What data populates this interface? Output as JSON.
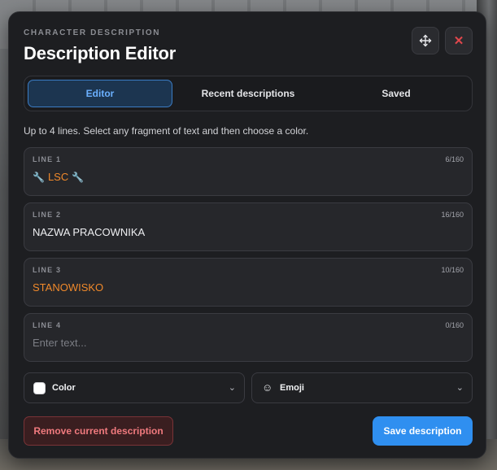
{
  "header": {
    "subtitle": "CHARACTER DESCRIPTION",
    "title": "Description Editor",
    "move_icon": "move-arrows-icon",
    "close_icon": "close-icon",
    "close_glyph": "✕"
  },
  "tabs": [
    {
      "label": "Editor",
      "active": true
    },
    {
      "label": "Recent descriptions",
      "active": false
    },
    {
      "label": "Saved",
      "active": false
    }
  ],
  "hint": "Up to 4 lines. Select any fragment of text and then choose a color.",
  "lines": [
    {
      "label": "LINE 1",
      "count": "6/160",
      "prefix_icon": "wrench-icon",
      "text": "LSC",
      "suffix_icon": "wrench-icon",
      "text_color": "#f0892b"
    },
    {
      "label": "LINE 2",
      "count": "16/160",
      "text": "NAZWA PRACOWNIKA",
      "text_color": "#eeeff2"
    },
    {
      "label": "LINE 3",
      "count": "10/160",
      "text": "STANOWISKO",
      "text_color": "#f0892b"
    },
    {
      "label": "LINE 4",
      "count": "0/160",
      "placeholder": "Enter text..."
    }
  ],
  "pickers": {
    "color": {
      "label": "Color",
      "swatch": "#ffffff",
      "chevron": "⌄"
    },
    "emoji": {
      "label": "Emoji",
      "icon": "smiley-icon",
      "glyph": "☺",
      "chevron": "⌄"
    }
  },
  "footer": {
    "remove_label": "Remove current description",
    "save_label": "Save description"
  },
  "colors": {
    "accent": "#2f8ff0",
    "danger": "#e0474c",
    "highlight": "#f0892b"
  }
}
